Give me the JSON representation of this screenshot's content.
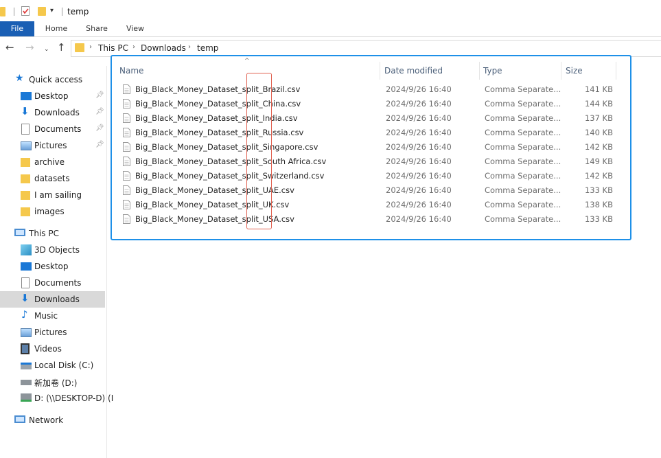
{
  "window": {
    "title": "temp"
  },
  "ribbon": {
    "tabs": [
      "File",
      "Home",
      "Share",
      "View"
    ]
  },
  "address": {
    "crumbs": [
      "This PC",
      "Downloads",
      "temp"
    ]
  },
  "nav": {
    "quick_access": {
      "label": "Quick access",
      "items": [
        {
          "label": "Desktop",
          "icon": "desktop-icon",
          "pinned": true
        },
        {
          "label": "Downloads",
          "icon": "downloads-icon",
          "pinned": true
        },
        {
          "label": "Documents",
          "icon": "documents-icon",
          "pinned": true
        },
        {
          "label": "Pictures",
          "icon": "pictures-icon",
          "pinned": true
        },
        {
          "label": "archive",
          "icon": "folder-icon",
          "pinned": false
        },
        {
          "label": "datasets",
          "icon": "folder-icon",
          "pinned": false
        },
        {
          "label": "I am sailing",
          "icon": "folder-icon",
          "pinned": false
        },
        {
          "label": "images",
          "icon": "folder-icon",
          "pinned": false
        }
      ]
    },
    "this_pc": {
      "label": "This PC",
      "items": [
        {
          "label": "3D Objects",
          "icon": "3d-objects-icon"
        },
        {
          "label": "Desktop",
          "icon": "desktop-icon"
        },
        {
          "label": "Documents",
          "icon": "documents-icon"
        },
        {
          "label": "Downloads",
          "icon": "downloads-icon"
        },
        {
          "label": "Music",
          "icon": "music-icon"
        },
        {
          "label": "Pictures",
          "icon": "pictures-icon"
        },
        {
          "label": "Videos",
          "icon": "videos-icon"
        },
        {
          "label": "Local Disk (C:)",
          "icon": "local-disk-icon"
        },
        {
          "label": "新加卷 (D:)",
          "icon": "drive-icon"
        },
        {
          "label": "D: (\\\\DESKTOP-D) (I",
          "icon": "network-drive-icon"
        }
      ]
    },
    "network": {
      "label": "Network"
    }
  },
  "columns": {
    "name": "Name",
    "date": "Date modified",
    "type": "Type",
    "size": "Size"
  },
  "files": [
    {
      "name": "Big_Black_Money_Dataset_split_Brazil.csv",
      "date": "2024/9/26 16:40",
      "type": "Comma Separate...",
      "size": "141 KB"
    },
    {
      "name": "Big_Black_Money_Dataset_split_China.csv",
      "date": "2024/9/26 16:40",
      "type": "Comma Separate...",
      "size": "144 KB"
    },
    {
      "name": "Big_Black_Money_Dataset_split_India.csv",
      "date": "2024/9/26 16:40",
      "type": "Comma Separate...",
      "size": "137 KB"
    },
    {
      "name": "Big_Black_Money_Dataset_split_Russia.csv",
      "date": "2024/9/26 16:40",
      "type": "Comma Separate...",
      "size": "140 KB"
    },
    {
      "name": "Big_Black_Money_Dataset_split_Singapore.csv",
      "date": "2024/9/26 16:40",
      "type": "Comma Separate...",
      "size": "142 KB"
    },
    {
      "name": "Big_Black_Money_Dataset_split_South Africa.csv",
      "date": "2024/9/26 16:40",
      "type": "Comma Separate...",
      "size": "149 KB"
    },
    {
      "name": "Big_Black_Money_Dataset_split_Switzerland.csv",
      "date": "2024/9/26 16:40",
      "type": "Comma Separate...",
      "size": "142 KB"
    },
    {
      "name": "Big_Black_Money_Dataset_split_UAE.csv",
      "date": "2024/9/26 16:40",
      "type": "Comma Separate...",
      "size": "133 KB"
    },
    {
      "name": "Big_Black_Money_Dataset_split_UK.csv",
      "date": "2024/9/26 16:40",
      "type": "Comma Separate...",
      "size": "138 KB"
    },
    {
      "name": "Big_Black_Money_Dataset_split_USA.csv",
      "date": "2024/9/26 16:40",
      "type": "Comma Separate...",
      "size": "133 KB"
    }
  ],
  "colors": {
    "accent": "#1a5fb4",
    "selection_border": "#1e90e8",
    "annotation": "#e0604f",
    "folder": "#f5c84c"
  }
}
